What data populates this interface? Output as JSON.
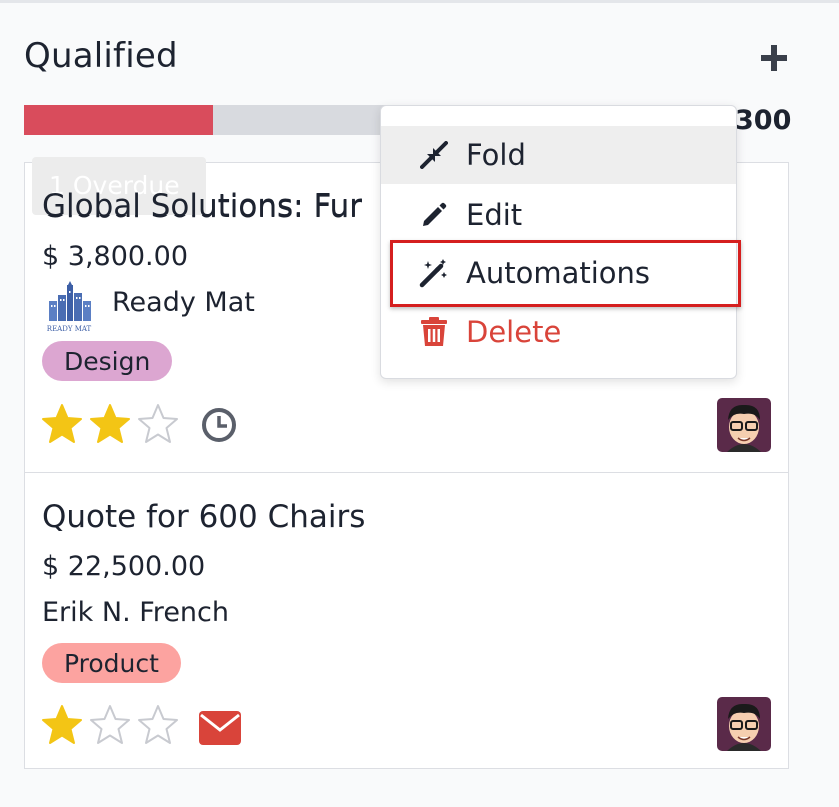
{
  "column": {
    "title": "Qualified",
    "total": "300",
    "progress_overdue_fraction": 0.27,
    "overdue_tooltip": "1 Overdue"
  },
  "menu": {
    "items": [
      {
        "label": "Fold",
        "icon": "compress-icon"
      },
      {
        "label": "Edit",
        "icon": "pencil-icon"
      },
      {
        "label": "Automations",
        "icon": "magic-wand-icon"
      },
      {
        "label": "Delete",
        "icon": "trash-icon"
      }
    ]
  },
  "cards": [
    {
      "title": "Global Solutions: Fur",
      "amount": "$ 3,800.00",
      "partner": "Ready Mat",
      "logo_text": "READY MAT",
      "tag": "Design",
      "tag_color": "#dca6d1",
      "rating": 2,
      "activity_icon": "clock-icon"
    },
    {
      "title": "Quote for 600 Chairs",
      "amount": "$ 22,500.00",
      "partner": "Erik N. French",
      "tag": "Product",
      "tag_color": "#fca3a0",
      "rating": 1,
      "activity_icon": "envelope-icon"
    }
  ],
  "colors": {
    "progress_overdue": "#d94c5c",
    "star_filled": "#f3c515",
    "delete_red": "#d9443a",
    "highlight": "#d51f1f"
  }
}
